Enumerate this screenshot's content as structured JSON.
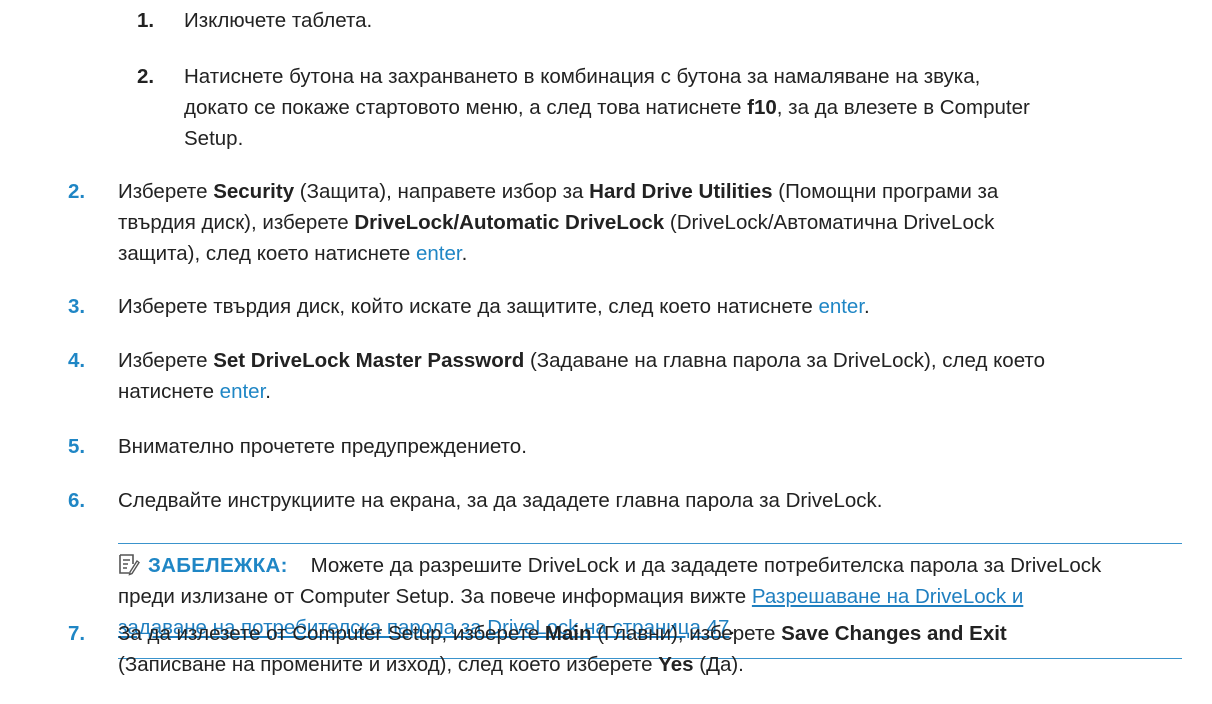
{
  "sub_steps": [
    {
      "num": "1.",
      "text": "Изключете таблета."
    },
    {
      "num": "2.",
      "text_1": "Натиснете бутона на захранването в комбинация с бутона за намаляване на звука,",
      "text_2": "докато се покаже стартовото меню, а след това натиснете ",
      "key": "f10",
      "text_3": ", за да влезете в Computer",
      "text_4": "Setup."
    }
  ],
  "steps": [
    {
      "num": "2.",
      "p1": "Изберете ",
      "b1": "Security",
      "p2": " (Защита), направете избор за ",
      "b2": "Hard Drive Utilities",
      "p3": " (Помощни програми за",
      "p4": "твърдия диск), изберете ",
      "b3": "DriveLock/Automatic DriveLock",
      "p5": " (DriveLock/Автоматична DriveLock",
      "p6": "защита), след което натиснете ",
      "k1": "enter",
      "p7": "."
    },
    {
      "num": "3.",
      "p1": "Изберете твърдия диск, който искате да защитите, след което натиснете ",
      "k1": "enter",
      "p2": "."
    },
    {
      "num": "4.",
      "p1": "Изберете ",
      "b1": "Set DriveLock Master Password",
      "p2": " (Задаване на главна парола за DriveLock), след което",
      "p3": "натиснете ",
      "k1": "enter",
      "p4": "."
    },
    {
      "num": "5.",
      "text": "Внимателно прочетете предупреждението."
    },
    {
      "num": "6.",
      "text": "Следвайте инструкциите на екрана, за да зададете главна парола за DriveLock."
    },
    {
      "num": "7.",
      "p1": "За да излезете от Computer Setup, изберете ",
      "b1": "Main",
      "p2": " (Главни), изберете ",
      "b2": "Save Changes and Exit",
      "p3": "(Записване на промените и изход), след което изберете ",
      "b3": "Yes",
      "p4": " (Да)."
    }
  ],
  "note": {
    "icon": "note-pencil-icon",
    "label": "ЗАБЕЛЕЖКА:",
    "line_1": "Можете да разрешите DriveLock и да зададете потребителска парола за DriveLock",
    "line_2": "преди излизане от Computer Setup. За повече информация вижте ",
    "link_1": "Разрешаване на DriveLock и",
    "link_2": "задаване на потребителска парола за DriveLock на страница 47",
    "end": "."
  },
  "colors": {
    "accent": "#1f86c5",
    "text": "#222222",
    "rule": "#3a93cc"
  }
}
